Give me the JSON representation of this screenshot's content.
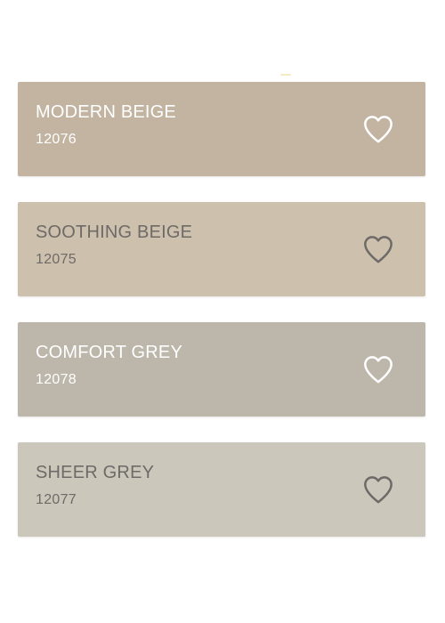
{
  "swatches": [
    {
      "name": "MODERN BEIGE",
      "code": "12076",
      "background": "#c2b4a1",
      "text_color": "#ffffff",
      "icon": "heart-outline-icon",
      "icon_color": "#ffffff"
    },
    {
      "name": "SOOTHING BEIGE",
      "code": "12075",
      "background": "#cdc1ad",
      "text_color": "#6e6a68",
      "icon": "heart-outline-icon",
      "icon_color": "#6e6a68"
    },
    {
      "name": "COMFORT GREY",
      "code": "12078",
      "background": "#bdb6aa",
      "text_color": "#ffffff",
      "icon": "heart-outline-icon",
      "icon_color": "#ffffff"
    },
    {
      "name": "SHEER GREY",
      "code": "12077",
      "background": "#ccc7bb",
      "text_color": "#6e6a68",
      "icon": "heart-outline-icon",
      "icon_color": "#6e6a68"
    }
  ]
}
